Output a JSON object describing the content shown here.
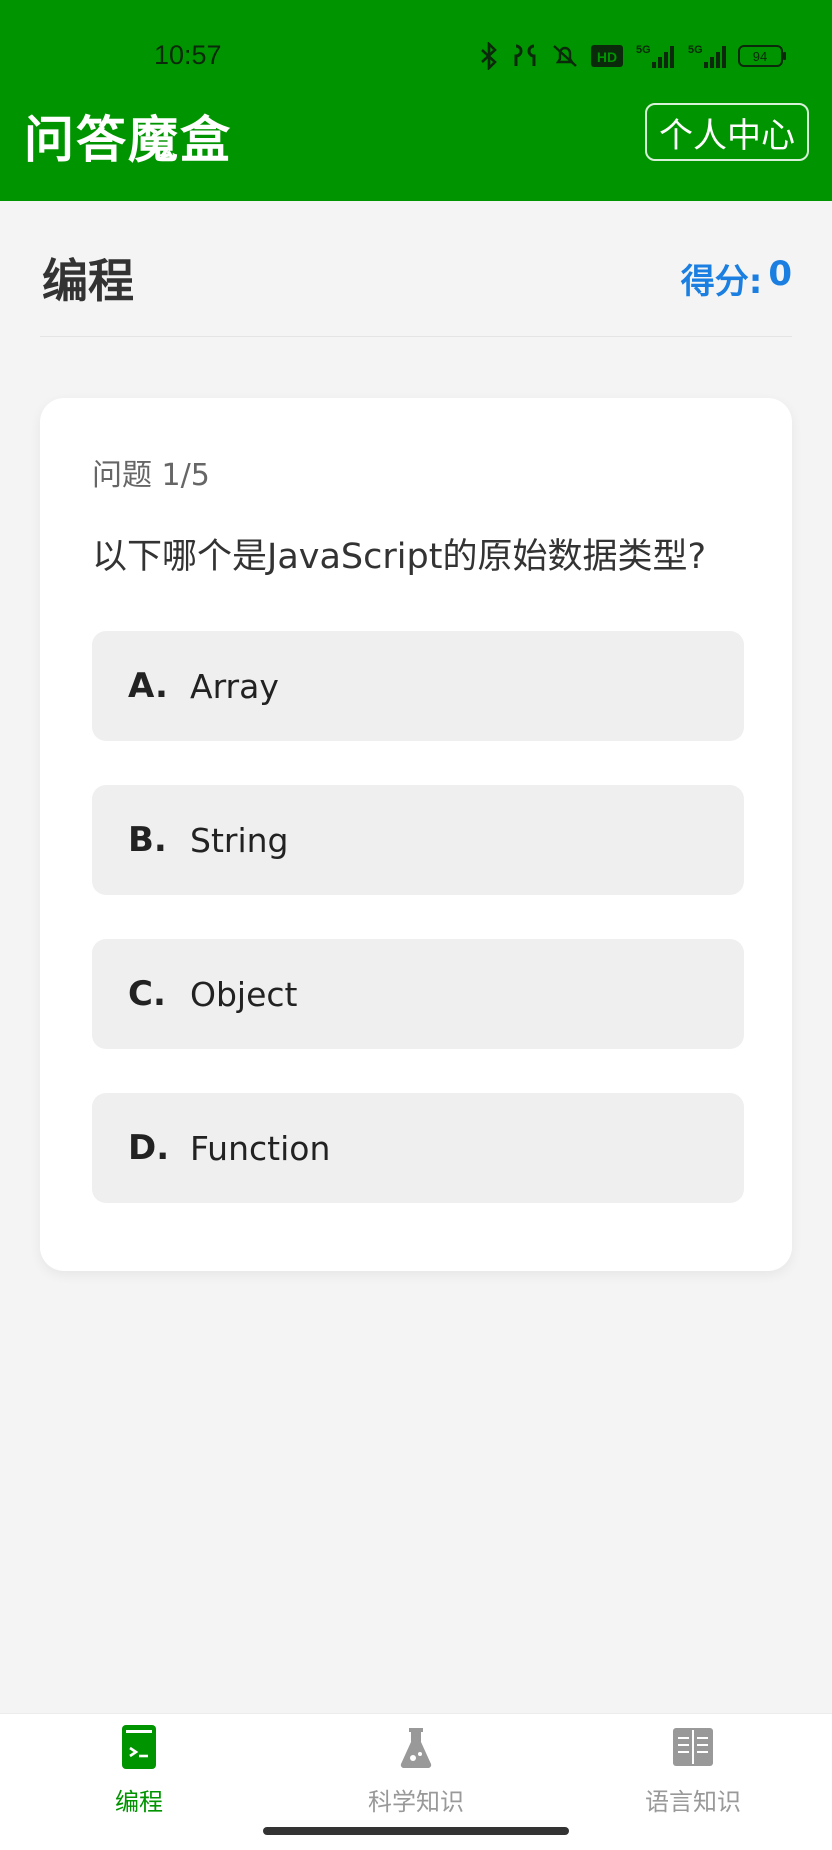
{
  "status_bar": {
    "time": "10:57",
    "battery": "94",
    "network_1": "5G",
    "network_2": "5G",
    "hd_badge": "HD",
    "icons": [
      "bluetooth-icon",
      "earbuds-icon",
      "mute-icon",
      "hd-icon",
      "signal-icon",
      "signal-icon",
      "battery-icon"
    ]
  },
  "header": {
    "app_title": "问答魔盒",
    "profile_button": "个人中心"
  },
  "section": {
    "title": "编程",
    "score_label": "得分:",
    "score_value": "0"
  },
  "question": {
    "progress": "问题 1/5",
    "text": "以下哪个是JavaScript的原始数据类型?",
    "options": [
      {
        "letter": "A.",
        "text": "Array"
      },
      {
        "letter": "B.",
        "text": "String"
      },
      {
        "letter": "C.",
        "text": "Object"
      },
      {
        "letter": "D.",
        "text": "Function"
      }
    ]
  },
  "tabs": [
    {
      "label": "编程",
      "icon": "code-book-icon",
      "active": true
    },
    {
      "label": "科学知识",
      "icon": "flask-icon",
      "active": false
    },
    {
      "label": "语言知识",
      "icon": "open-book-icon",
      "active": false
    }
  ],
  "colors": {
    "brand_green": "#009400",
    "score_blue": "#1a7fe0",
    "option_bg": "#efefef",
    "inactive_tab": "#999999"
  }
}
